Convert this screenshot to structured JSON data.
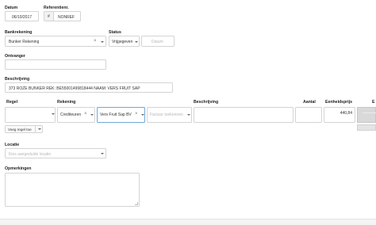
{
  "datum": {
    "label": "Datum",
    "value": "06/10/2017"
  },
  "referentie": {
    "label": "Referentienr.",
    "hash": "#",
    "value": "NONREF"
  },
  "bankrekening": {
    "label": "Bankrekening",
    "value": "Bunker Rekening"
  },
  "status": {
    "label": "Status",
    "value": "Vrijgegeven",
    "datum_placeholder": "Datum"
  },
  "ontvanger": {
    "label": "Ontvanger",
    "value": ""
  },
  "beschrijving": {
    "label": "Beschrijving",
    "value": "373 ROZE BUNKER REK: BE55001499818444 NAAM: VERS FRUIT SAP"
  },
  "table": {
    "headers": {
      "regel": "Regel",
      "rekening": "Rekening",
      "beschrijving": "Beschrijving",
      "aantal": "Aantal",
      "eenheidsprijs": "Eenheidsprijs",
      "more": "E"
    },
    "row": {
      "regel": "",
      "rekening": "Crediteuren",
      "relatie": "Vers Fruit Sap BV",
      "factuur_placeholder": "Factuur toekennen",
      "beschrijving": "",
      "aantal": "",
      "eenheidsprijs": "440,84"
    }
  },
  "add_line": {
    "label": "Voeg regel toe"
  },
  "locatie": {
    "label": "Locatie",
    "placeholder": "Kies aangeduide locatie"
  },
  "opmerkingen": {
    "label": "Opmerkingen",
    "value": ""
  }
}
